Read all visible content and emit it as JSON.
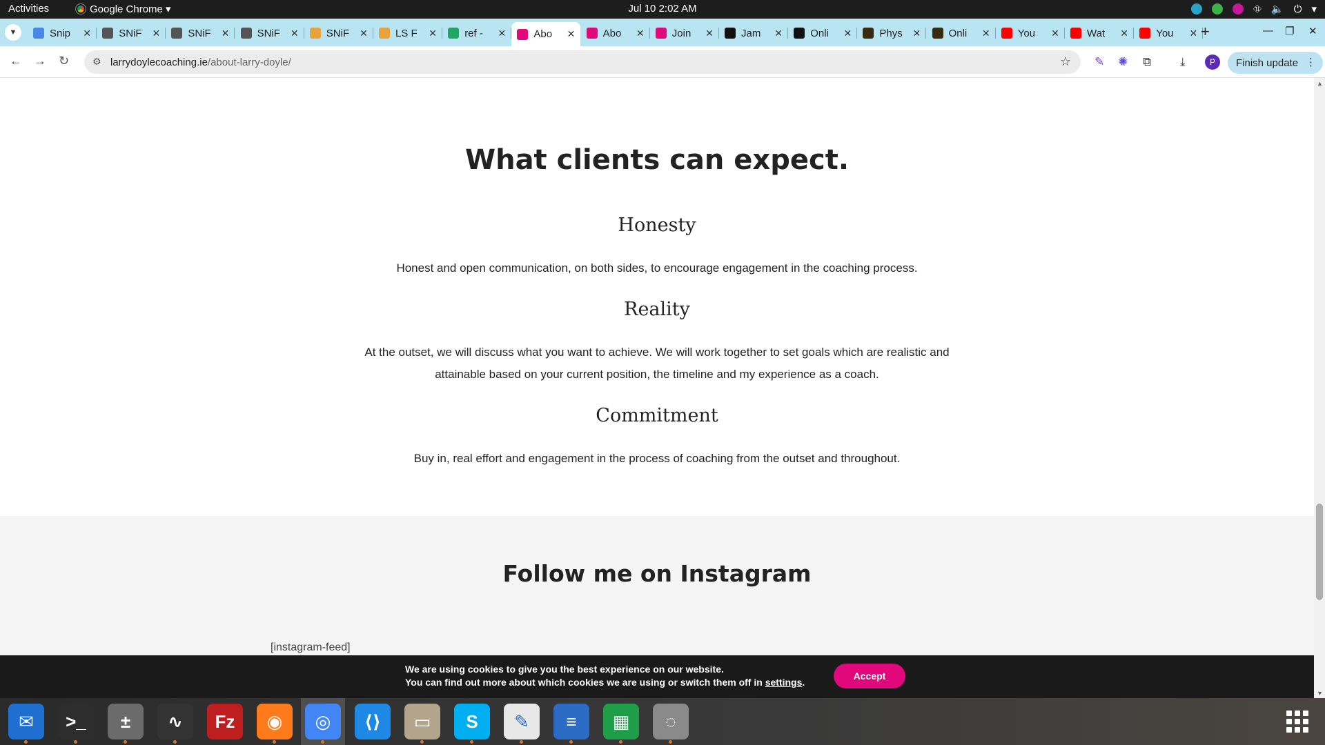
{
  "system_bar": {
    "activities": "Activities",
    "app_name": "Google Chrome ▾",
    "clock": "Jul 10  2:02 AM"
  },
  "tabs": [
    {
      "title": "Snip",
      "color": "#4a86e8"
    },
    {
      "title": "SNiF",
      "color": "#555555"
    },
    {
      "title": "SNiF",
      "color": "#555555"
    },
    {
      "title": "SNiF",
      "color": "#555555"
    },
    {
      "title": "SNiF",
      "color": "#e8a33a"
    },
    {
      "title": "LS F",
      "color": "#e8a33a"
    },
    {
      "title": "ref -",
      "color": "#23a566"
    },
    {
      "title": "Abo",
      "color": "#e0087a",
      "active": true
    },
    {
      "title": "Abo",
      "color": "#e0087a"
    },
    {
      "title": "Join",
      "color": "#e0087a"
    },
    {
      "title": "Jam",
      "color": "#111111"
    },
    {
      "title": "Onli",
      "color": "#111111"
    },
    {
      "title": "Phys",
      "color": "#3a2a10"
    },
    {
      "title": "Onli",
      "color": "#3a2a10"
    },
    {
      "title": "You",
      "color": "#ff0000"
    },
    {
      "title": "Wat",
      "color": "#ff0000"
    },
    {
      "title": "You",
      "color": "#ff0000"
    }
  ],
  "toolbar": {
    "url_domain": "larrydoylecoaching.ie",
    "url_path": "/about-larry-doyle/",
    "profile_initial": "P",
    "finish_update": "Finish update"
  },
  "page": {
    "expect_heading": "What clients can expect.",
    "items": [
      {
        "title": "Honesty",
        "lines": [
          "Honest and open communication, on both sides, to encourage engagement in the coaching process."
        ]
      },
      {
        "title": "Reality",
        "lines": [
          "At the outset, we will discuss what you want to achieve. We will work together to set goals which are realistic and",
          "attainable based on your current position, the timeline and my experience as a coach."
        ]
      },
      {
        "title": "Commitment",
        "lines": [
          "Buy in, real effort and engagement in the process of coaching from the outset and throughout."
        ]
      }
    ],
    "instagram_heading": "Follow me on Instagram",
    "instagram_shortcode": "[instagram-feed]"
  },
  "cookie": {
    "line1": "We are using cookies to give you the best experience on our website.",
    "line2_prefix": "You can find out more about which cookies we are using or switch them off in ",
    "settings_link": "settings",
    "line2_suffix": ".",
    "accept": "Accept",
    "accent_color": "#e0087a"
  },
  "dock": [
    {
      "name": "thunderbird",
      "glyph": "✉",
      "bg": "#1f6fd1",
      "running": true
    },
    {
      "name": "terminal",
      "glyph": ">_",
      "bg": "#2d2d2d",
      "running": true
    },
    {
      "name": "calculator",
      "glyph": "±",
      "bg": "#6b6b6b",
      "running": true
    },
    {
      "name": "system-monitor",
      "glyph": "∿",
      "bg": "#333333",
      "running": true
    },
    {
      "name": "filezilla",
      "glyph": "Fz",
      "bg": "#bf1e1e",
      "running": false
    },
    {
      "name": "firefox",
      "glyph": "◉",
      "bg": "#ff7a1a",
      "running": true
    },
    {
      "name": "chrome",
      "glyph": "◎",
      "bg": "#4285f4",
      "running": true
    },
    {
      "name": "vscode",
      "glyph": "⟨⟩",
      "bg": "#1e88e5",
      "running": false
    },
    {
      "name": "files",
      "glyph": "▭",
      "bg": "#b3a58c",
      "running": true
    },
    {
      "name": "skype",
      "glyph": "S",
      "bg": "#00aff0",
      "running": true
    },
    {
      "name": "text-editor",
      "glyph": "✎",
      "bg": "#e8e8e8",
      "running": true
    },
    {
      "name": "writer",
      "glyph": "≡",
      "bg": "#2b6bc4",
      "running": true
    },
    {
      "name": "calc",
      "glyph": "▦",
      "bg": "#1f9e4a",
      "running": true
    },
    {
      "name": "disc",
      "glyph": "◌",
      "bg": "#8a8a8a",
      "running": true
    }
  ]
}
